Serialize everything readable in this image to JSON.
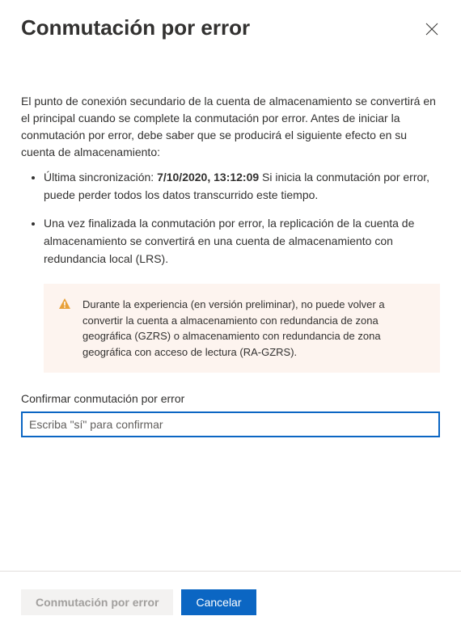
{
  "dialog": {
    "title": "Conmutación por error",
    "intro": "El punto de conexión secundario de la cuenta de almacenamiento se convertirá en el principal cuando se complete la conmutación por error. Antes de iniciar la conmutación por error, debe saber que se producirá el siguiente efecto en su cuenta de almacenamiento:",
    "bullet1_pre": "Última sincronización: ",
    "bullet1_time": "7/10/2020, 13:12:09",
    "bullet1_post": " Si inicia la conmutación por error, puede perder todos los datos transcurrido este tiempo.",
    "bullet2": "Una vez finalizada la conmutación por error, la replicación de la cuenta de almacenamiento se convertirá en una cuenta de almacenamiento con redundancia local (LRS).",
    "warning": "Durante la experiencia (en versión preliminar), no puede volver a convertir la cuenta a almacenamiento con redundancia de zona geográfica (GZRS) o almacenamiento con redundancia de zona geográfica con acceso de lectura (RA-GZRS).",
    "confirm_label": "Confirmar conmutación por error",
    "confirm_placeholder": "Escriba \"sí\" para confirmar"
  },
  "footer": {
    "primary_action": "Conmutación por error",
    "cancel": "Cancelar"
  }
}
